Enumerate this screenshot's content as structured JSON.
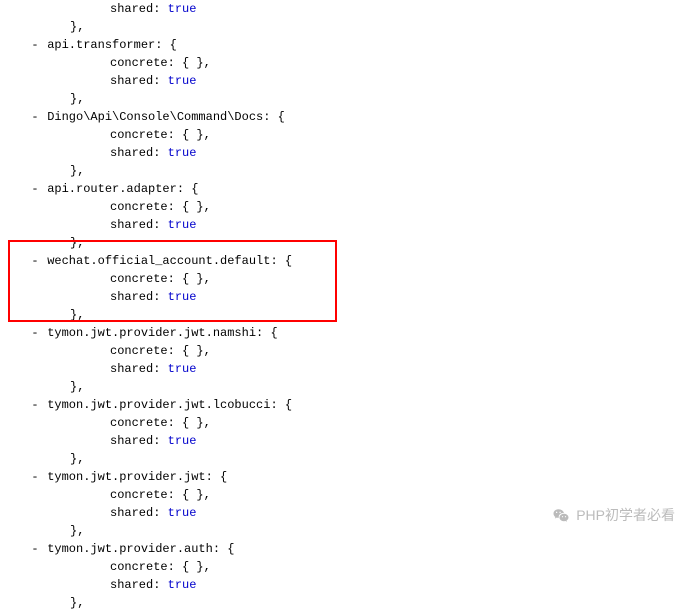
{
  "blocks": [
    {
      "key": null,
      "shared_label": "shared",
      "concrete_label": null,
      "shared_value": "true",
      "tail_only": true
    },
    {
      "key": "api.transformer",
      "concrete_label": "concrete",
      "concrete_value": "{ }",
      "shared_label": "shared",
      "shared_value": "true"
    },
    {
      "key": "Dingo\\Api\\Console\\Command\\Docs",
      "concrete_label": "concrete",
      "concrete_value": "{ }",
      "shared_label": "shared",
      "shared_value": "true"
    },
    {
      "key": "api.router.adapter",
      "concrete_label": "concrete",
      "concrete_value": "{ }",
      "shared_label": "shared",
      "shared_value": "true"
    },
    {
      "key": "wechat.official_account.default",
      "concrete_label": "concrete",
      "concrete_value": "{ }",
      "shared_label": "shared",
      "shared_value": "true",
      "highlight": true
    },
    {
      "key": "tymon.jwt.provider.jwt.namshi",
      "concrete_label": "concrete",
      "concrete_value": "{ }",
      "shared_label": "shared",
      "shared_value": "true"
    },
    {
      "key": "tymon.jwt.provider.jwt.lcobucci",
      "concrete_label": "concrete",
      "concrete_value": "{ }",
      "shared_label": "shared",
      "shared_value": "true"
    },
    {
      "key": "tymon.jwt.provider.jwt",
      "concrete_label": "concrete",
      "concrete_value": "{ }",
      "shared_label": "shared",
      "shared_value": "true"
    },
    {
      "key": "tymon.jwt.provider.auth",
      "concrete_label": "concrete",
      "concrete_value": "{ }",
      "shared_label": "shared",
      "shared_value": "true"
    }
  ],
  "watermark_text": "PHP初学者必看",
  "toggle_glyph": "-"
}
